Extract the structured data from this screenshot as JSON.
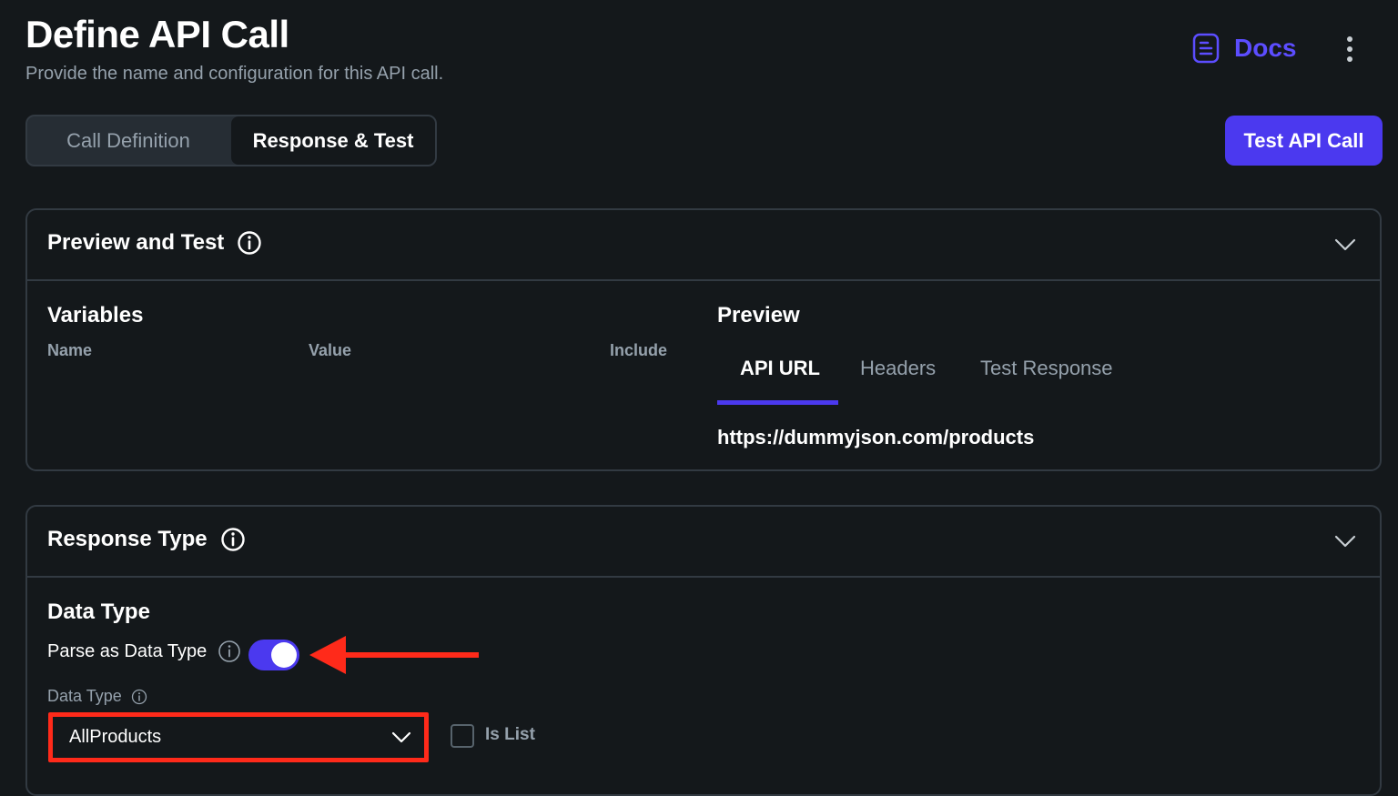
{
  "header": {
    "title": "Define API Call",
    "subtitle": "Provide the name and configuration for this API call.",
    "docs_label": "Docs",
    "docs_icon": "document-icon",
    "more_icon": "more-vertical-icon"
  },
  "mode_tabs": [
    {
      "label": "Call Definition",
      "active": false
    },
    {
      "label": "Response & Test",
      "active": true
    }
  ],
  "test_button_label": "Test API Call",
  "colors": {
    "background": "#14181b",
    "accent": "#4b39ef",
    "docs_text": "#5c4dff",
    "border": "#323a42",
    "muted_text": "#95a1ac",
    "annotation_red": "#ff2a1a"
  },
  "preview_card": {
    "title": "Preview and Test",
    "variables": {
      "heading": "Variables",
      "columns": [
        "Name",
        "Value",
        "Include"
      ]
    },
    "preview": {
      "heading": "Preview",
      "tabs": [
        {
          "label": "API URL",
          "active": true
        },
        {
          "label": "Headers",
          "active": false
        },
        {
          "label": "Test Response",
          "active": false
        }
      ],
      "url": "https://dummyjson.com/products"
    }
  },
  "response_card": {
    "title": "Response Type",
    "data_type_heading": "Data Type",
    "parse_label": "Parse as Data Type",
    "parse_enabled": true,
    "data_type_field_label": "Data Type",
    "data_type_value": "AllProducts",
    "is_list_label": "Is List",
    "is_list_checked": false
  }
}
